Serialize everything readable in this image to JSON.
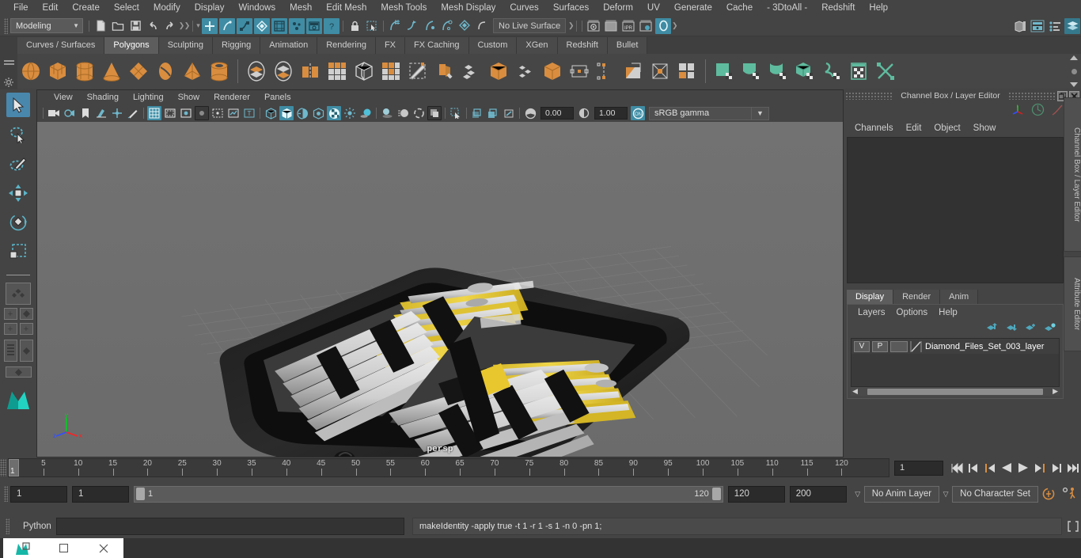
{
  "menubar": {
    "items": [
      "File",
      "Edit",
      "Create",
      "Select",
      "Modify",
      "Display",
      "Windows",
      "Mesh",
      "Edit Mesh",
      "Mesh Tools",
      "Mesh Display",
      "Curves",
      "Surfaces",
      "Deform",
      "UV",
      "Generate",
      "Cache",
      "- 3DtoAll -",
      "Redshift",
      "Help"
    ]
  },
  "statusline": {
    "mode": "Modeling",
    "live_surface": "No Live Surface"
  },
  "shelf": {
    "tabs": [
      "Curves / Surfaces",
      "Polygons",
      "Sculpting",
      "Rigging",
      "Animation",
      "Rendering",
      "FX",
      "FX Caching",
      "Custom",
      "XGen",
      "Redshift",
      "Bullet"
    ],
    "active_tab": "Polygons"
  },
  "viewport": {
    "menus": [
      "View",
      "Shading",
      "Lighting",
      "Show",
      "Renderer",
      "Panels"
    ],
    "exposure": "0.00",
    "gamma_value": "1.00",
    "color_space": "sRGB gamma",
    "camera_label": "persp",
    "axis": {
      "x": "x",
      "y": "y",
      "z": "z"
    }
  },
  "channelbox": {
    "title": "Channel Box / Layer Editor",
    "menus": [
      "Channels",
      "Edit",
      "Object",
      "Show"
    ],
    "side_tabs": [
      "Channel Box / Layer Editor",
      "Attribute Editor"
    ]
  },
  "layereditor": {
    "tabs": [
      "Display",
      "Render",
      "Anim"
    ],
    "active_tab": "Display",
    "menus": [
      "Layers",
      "Options",
      "Help"
    ],
    "layers": [
      {
        "visible": "V",
        "playback": "P",
        "shade": "",
        "name": "Diamond_Files_Set_003_layer",
        "color": "#7f7f7f"
      }
    ]
  },
  "timeslider": {
    "current_frame": "1",
    "ticks": [
      5,
      10,
      15,
      20,
      25,
      30,
      35,
      40,
      45,
      50,
      55,
      60,
      65,
      70,
      75,
      80,
      85,
      90,
      95,
      100,
      105,
      110,
      115,
      120
    ],
    "range_start": 1,
    "range_end": 120,
    "frame_field": "1"
  },
  "rangeslider": {
    "anim_start": "1",
    "range_start": "1",
    "slider_start_label": "1",
    "slider_end_label": "120",
    "range_end": "120",
    "anim_end": "200",
    "anim_layer": "No Anim Layer",
    "character_set": "No Character Set"
  },
  "commandline": {
    "label": "Python",
    "input_value": "",
    "echo": "makeIdentity -apply true -t 1 -r 1 -s 1 -n 0 -pn 1;"
  },
  "colors": {
    "accent_blue": "#3f8ca4",
    "accent_orange": "#d98d3f",
    "bg_panel": "#444444",
    "selected_tool": "#4a87ad",
    "viewport_bg": "#6e6e6e"
  }
}
